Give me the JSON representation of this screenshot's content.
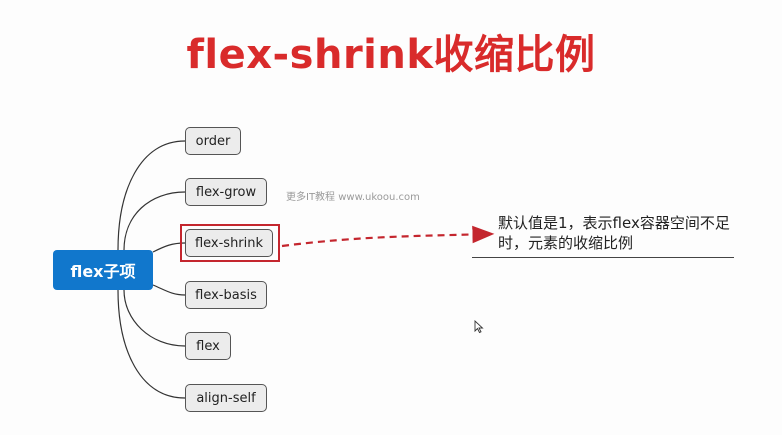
{
  "title": "flex-shrink收缩比例",
  "root": {
    "label": "flex子项"
  },
  "nodes": [
    {
      "label": "order"
    },
    {
      "label": "flex-grow"
    },
    {
      "label": "flex-shrink",
      "highlighted": true
    },
    {
      "label": "flex-basis"
    },
    {
      "label": "flex"
    },
    {
      "label": "align-self"
    }
  ],
  "watermark": "更多IT教程 www.ukoou.com",
  "note": "默认值是1，表示flex容器空间不足时，元素的收缩比例",
  "colors": {
    "title": "#d92b2b",
    "root": "#1177cc",
    "highlight": "#c4262e",
    "arrow": "#c4262e"
  }
}
